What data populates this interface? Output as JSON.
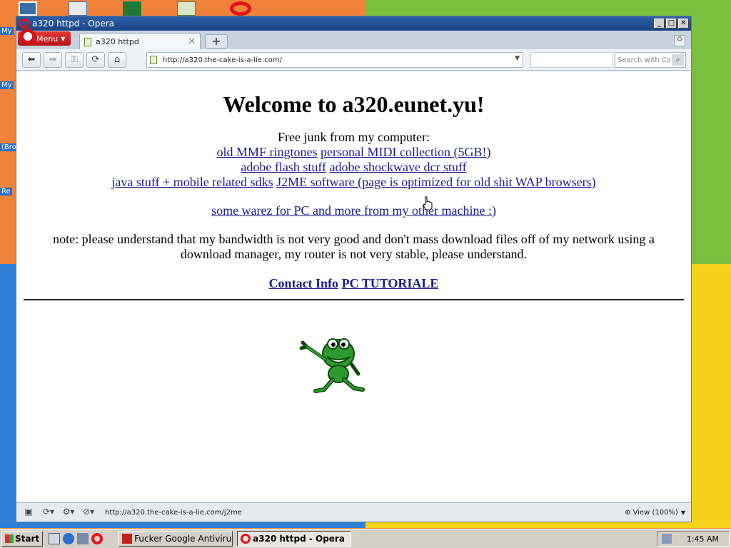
{
  "window": {
    "title": "a320 httpd - Opera"
  },
  "browser": {
    "menu_label": "Menu",
    "tab_title": "a320 httpd",
    "address": "http://a320.the-cake-is-a-lie.com/",
    "search_placeholder": "Search with Co",
    "status_url": "http://a320.the-cake-is-a-lie.com/j2me",
    "zoom_label": "View (100%)"
  },
  "page": {
    "heading": "Welcome to a320.eunet.yu!",
    "intro": "Free junk from my computer:",
    "links_row1": [
      "old MMF ringtones",
      "personal MIDI collection (5GB!)"
    ],
    "links_row2": [
      "adobe flash stuff",
      "adobe shockwave dcr stuff"
    ],
    "links_row3": [
      "java stuff + mobile related sdks",
      "J2ME software (page is optimized for old shit WAP browsers)"
    ],
    "warez_link": "some warez for PC and more from my other machine :)",
    "note": "note: please understand that my bandwidth is not very good and don't mass download files off of my network using a download manager, my router is not very stable, please understand.",
    "contact_link": "Contact Info",
    "tutorial_link": "PC TUTORIALE"
  },
  "desktop": {
    "labels": [
      "My",
      "My",
      "(Bro",
      "Re"
    ]
  },
  "taskbar": {
    "start_label": "Start",
    "tasks": [
      "Fucker Google Antiviru...",
      "a320 httpd - Opera"
    ],
    "clock": "1:45 AM"
  },
  "colors": {
    "link": "#1a1a8e",
    "title_bar": "#1b4586",
    "opera_red": "#d8101a"
  }
}
